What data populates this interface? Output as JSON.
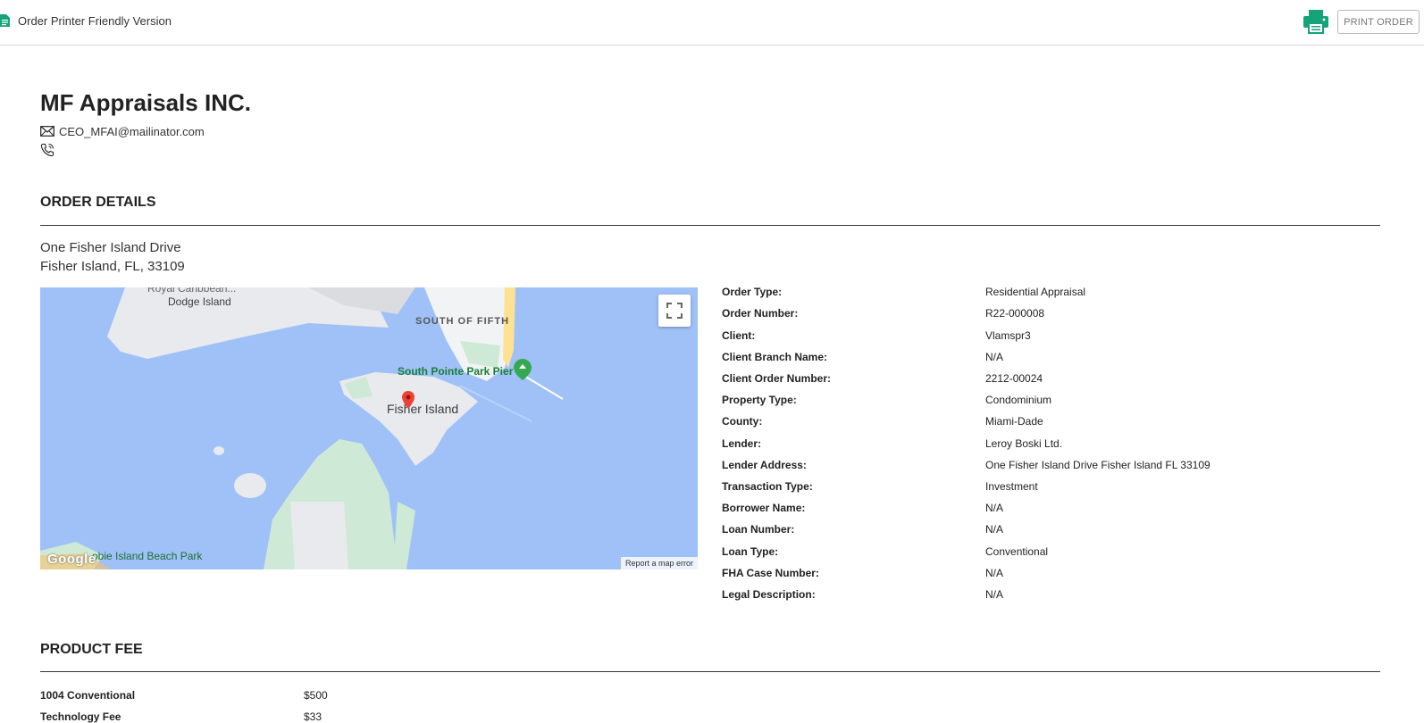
{
  "topbar": {
    "title": "Order Printer Friendly Version",
    "print_button": "PRINT ORDER",
    "icons": {
      "document": "document-icon",
      "printer": "printer-icon"
    },
    "accent_color": "#16a37a"
  },
  "company": {
    "name": "MF Appraisals INC.",
    "email": "CEO_MFAI@mailinator.com",
    "icons": {
      "email": "envelope-icon",
      "phone": "phone-icon"
    }
  },
  "order_details": {
    "heading": "ORDER DETAILS",
    "address_line1": "One Fisher Island Drive",
    "address_line2": "Fisher Island, FL, 33109",
    "map": {
      "labels": {
        "royal": "Royal Caribbean...",
        "dodge": "Dodge Island",
        "south_of_fifth": "SOUTH OF FIFTH",
        "pier": "South Pointe Park Pier",
        "fisher": "Fisher Island",
        "beach_park": "obie Island Beach Park",
        "google": "Google"
      },
      "report_link": "Report a map error",
      "icons": {
        "fullscreen": "fullscreen-icon",
        "pin": "map-pin-icon",
        "pier": "pier-marker-icon"
      }
    },
    "fields": [
      {
        "label": "Order Type:",
        "value": "Residential Appraisal"
      },
      {
        "label": "Order Number:",
        "value": "R22-000008"
      },
      {
        "label": "Client:",
        "value": "Vlamspr3"
      },
      {
        "label": "Client Branch Name:",
        "value": "N/A"
      },
      {
        "label": "Client Order Number:",
        "value": "2212-00024"
      },
      {
        "label": "Property Type:",
        "value": "Condominium"
      },
      {
        "label": "County:",
        "value": "Miami-Dade"
      },
      {
        "label": "Lender:",
        "value": "Leroy Boski Ltd."
      },
      {
        "label": "Lender Address:",
        "value": "One Fisher Island Drive Fisher Island FL 33109"
      },
      {
        "label": "Transaction Type:",
        "value": "Investment"
      },
      {
        "label": "Borrower Name:",
        "value": "N/A"
      },
      {
        "label": "Loan Number:",
        "value": "N/A"
      },
      {
        "label": "Loan Type:",
        "value": "Conventional"
      },
      {
        "label": "FHA Case Number:",
        "value": "N/A"
      },
      {
        "label": "Legal Description:",
        "value": "N/A"
      }
    ]
  },
  "product_fee": {
    "heading": "PRODUCT FEE",
    "items": [
      {
        "label": "1004 Conventional",
        "value": "$500"
      },
      {
        "label": "Technology Fee",
        "value": "$33"
      }
    ]
  }
}
